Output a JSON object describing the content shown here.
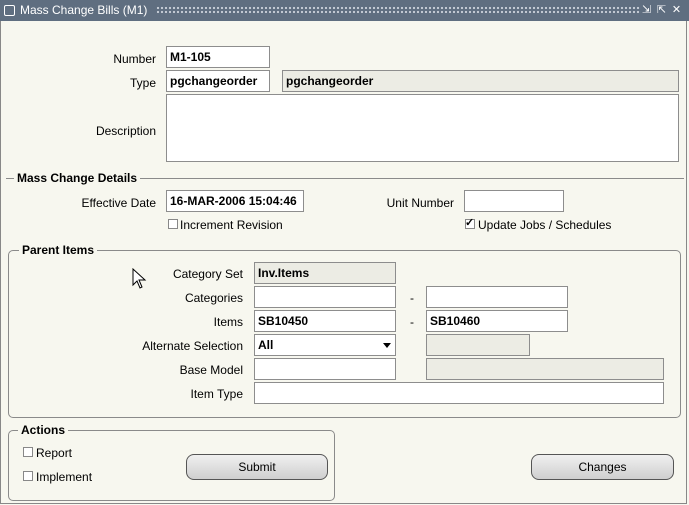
{
  "window": {
    "title": "Mass Change Bills (M1)"
  },
  "header": {
    "number_label": "Number",
    "number_value": "M1-105",
    "type_label": "Type",
    "type_value": "pgchangeorder",
    "type_desc": "pgchangeorder",
    "description_label": "Description",
    "description_value": ""
  },
  "details": {
    "heading": "Mass Change Details",
    "effective_date_label": "Effective Date",
    "effective_date_value": "16-MAR-2006 15:04:46",
    "unit_number_label": "Unit Number",
    "unit_number_value": "",
    "increment_revision_label": "Increment Revision",
    "increment_revision_checked": false,
    "update_jobs_label": "Update Jobs / Schedules",
    "update_jobs_checked": true
  },
  "parent_items": {
    "heading": "Parent Items",
    "category_set_label": "Category Set",
    "category_set_value": "Inv.Items",
    "categories_label": "Categories",
    "categories_from": "",
    "categories_to": "",
    "items_label": "Items",
    "items_from": "SB10450",
    "items_to": "SB10460",
    "alternate_selection_label": "Alternate Selection",
    "alternate_selection_value": "All",
    "alternate_value": "",
    "base_model_label": "Base Model",
    "base_model_value": "",
    "base_model_desc": "",
    "item_type_label": "Item Type",
    "item_type_value": "",
    "range_dash": "-"
  },
  "actions": {
    "heading": "Actions",
    "report_label": "Report",
    "report_checked": false,
    "implement_label": "Implement",
    "implement_checked": false,
    "submit_label": "Submit"
  },
  "changes_label": "Changes",
  "colors": {
    "titlebar": "#5f6e80",
    "background": "#f7f7ef",
    "readonly_field": "#ecece4"
  }
}
